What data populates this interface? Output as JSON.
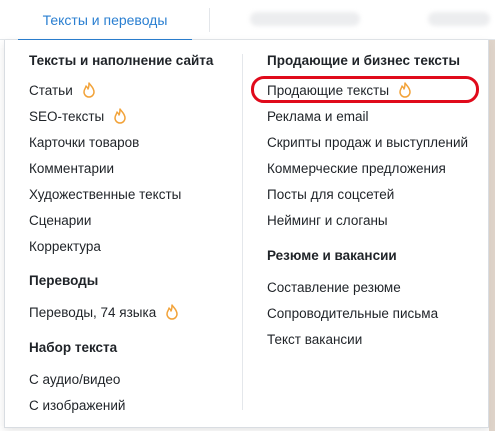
{
  "topbar": {
    "active_tab": "Тексты и переводы"
  },
  "colors": {
    "accent": "#2a7fd1",
    "fire_icon": "#f2a33a",
    "highlight": "#e00a1b"
  },
  "menu": {
    "left": {
      "texts": {
        "title": "Тексты и наполнение сайта",
        "items": [
          {
            "label": "Статьи",
            "icon": "fire-icon"
          },
          {
            "label": "SEO-тексты",
            "icon": "fire-icon"
          },
          {
            "label": "Карточки товаров"
          },
          {
            "label": "Комментарии"
          },
          {
            "label": "Художественные тексты"
          },
          {
            "label": "Сценарии"
          },
          {
            "label": "Корректура"
          }
        ]
      },
      "translations": {
        "title": "Переводы",
        "items": [
          {
            "label": "Переводы, 74 языка",
            "icon": "fire-icon"
          }
        ]
      },
      "typing": {
        "title": "Набор текста",
        "items": [
          {
            "label": "С аудио/видео"
          },
          {
            "label": "С изображений"
          }
        ]
      }
    },
    "right": {
      "business": {
        "title": "Продающие и бизнес тексты",
        "items": [
          {
            "label": "Продающие тексты",
            "icon": "fire-icon",
            "highlighted": true
          },
          {
            "label": "Реклама и email"
          },
          {
            "label": "Скрипты продаж и выступлений"
          },
          {
            "label": "Коммерческие предложения"
          },
          {
            "label": "Посты для соцсетей"
          },
          {
            "label": "Нейминг и слоганы"
          }
        ]
      },
      "resume": {
        "title": "Резюме и вакансии",
        "items": [
          {
            "label": "Составление резюме"
          },
          {
            "label": "Сопроводительные письма"
          },
          {
            "label": "Текст вакансии"
          }
        ]
      }
    }
  }
}
